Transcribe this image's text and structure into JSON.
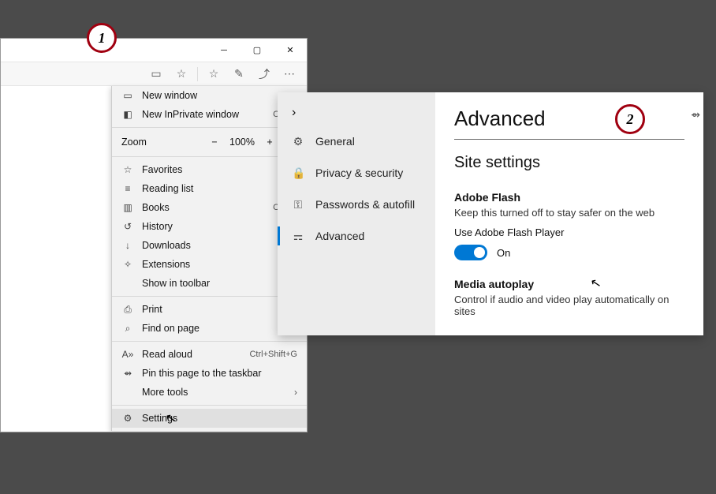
{
  "callouts": {
    "one": "1",
    "two": "2"
  },
  "menu": {
    "newWindow": "New window",
    "newInPrivate": "New InPrivate window",
    "newInPrivateShortcut": "Ctrl+S",
    "zoomLabel": "Zoom",
    "zoomValue": "100%",
    "favorites": "Favorites",
    "readingList": "Reading list",
    "books": "Books",
    "booksShortcut": "Ctrl+S",
    "history": "History",
    "downloads": "Downloads",
    "extensions": "Extensions",
    "showInToolbar": "Show in toolbar",
    "print": "Print",
    "findOnPage": "Find on page",
    "readAloud": "Read aloud",
    "readAloudShortcut": "Ctrl+Shift+G",
    "pinToTaskbar": "Pin this page to the taskbar",
    "moreTools": "More tools",
    "settings": "Settings"
  },
  "settingsNav": {
    "general": "General",
    "privacy": "Privacy & security",
    "passwords": "Passwords & autofill",
    "advanced": "Advanced"
  },
  "advanced": {
    "title": "Advanced",
    "sectionHeading": "Site settings",
    "flashTitle": "Adobe Flash",
    "flashSub": "Keep this turned off to stay safer on the web",
    "flashToggleLabel": "Use Adobe Flash Player",
    "flashState": "On",
    "mediaTitle": "Media autoplay",
    "mediaSub": "Control if audio and video play automatically on sites"
  }
}
